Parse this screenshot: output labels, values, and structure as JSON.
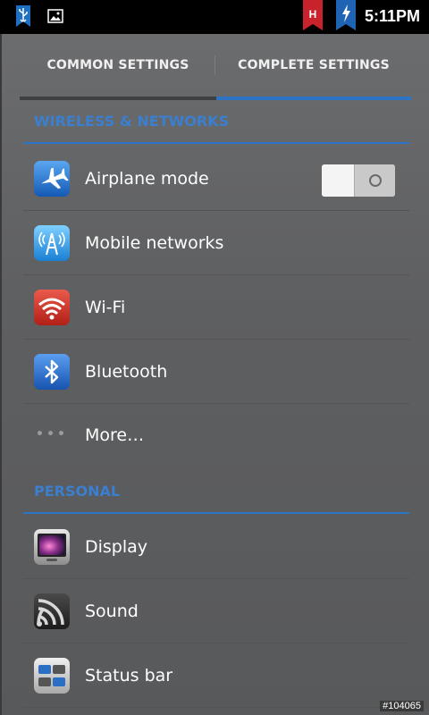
{
  "status_bar": {
    "time": "5:11PM",
    "left_icons": [
      "usb-icon",
      "image-icon"
    ],
    "right_icons": [
      {
        "name": "h-network-icon",
        "label": "H",
        "color": "#c8232c"
      },
      {
        "name": "charging-icon",
        "color": "#1e63b4"
      }
    ]
  },
  "tabs": {
    "items": [
      {
        "label": "COMMON SETTINGS",
        "active": false
      },
      {
        "label": "COMPLETE SETTINGS",
        "active": true
      }
    ],
    "active_color": "#2e74c6"
  },
  "sections": [
    {
      "header": "WIRELESS & NETWORKS",
      "items": [
        {
          "label": "Airplane mode",
          "icon": "airplane-icon",
          "toggle": "off"
        },
        {
          "label": "Mobile networks",
          "icon": "antenna-icon"
        },
        {
          "label": "Wi-Fi",
          "icon": "wifi-icon"
        },
        {
          "label": "Bluetooth",
          "icon": "bluetooth-icon"
        },
        {
          "label": "More…",
          "icon": "more-dots-icon"
        }
      ]
    },
    {
      "header": "PERSONAL",
      "items": [
        {
          "label": "Display",
          "icon": "display-icon"
        },
        {
          "label": "Sound",
          "icon": "sound-icon"
        },
        {
          "label": "Status bar",
          "icon": "status-bar-icon"
        }
      ]
    }
  ],
  "watermark": "#104065",
  "colors": {
    "accent": "#2e74c6",
    "header_text": "#3a7fd0",
    "background": "#5f6062"
  }
}
